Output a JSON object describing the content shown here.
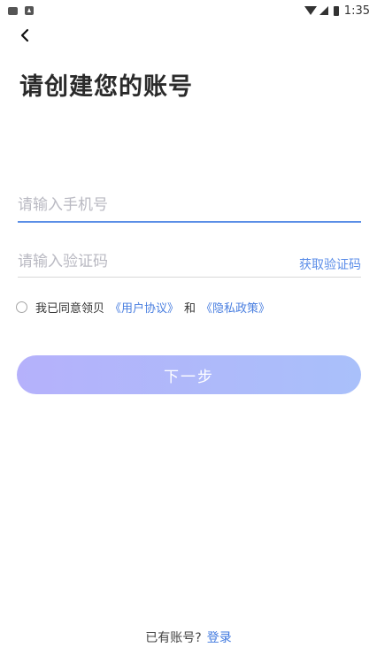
{
  "status_bar": {
    "time": "1:35"
  },
  "nav": {
    "back_icon": "chevron-left-icon"
  },
  "page": {
    "title": "请创建您的账号"
  },
  "form": {
    "phone_placeholder": "请输入手机号",
    "phone_value": "",
    "code_placeholder": "请输入验证码",
    "code_value": "",
    "get_code_label": "获取验证码"
  },
  "agreement": {
    "checked": false,
    "prefix": "我已同意领贝",
    "user_agreement": "《用户协议》",
    "and": "和",
    "privacy_policy": "《隐私政策》"
  },
  "actions": {
    "next_label": "下一步"
  },
  "footer": {
    "prompt": "已有账号?",
    "login_label": "登录"
  },
  "colors": {
    "accent": "#4a7fe0",
    "button_gradient_start": "#b5b1fb",
    "button_gradient_end": "#a9c0fa"
  }
}
